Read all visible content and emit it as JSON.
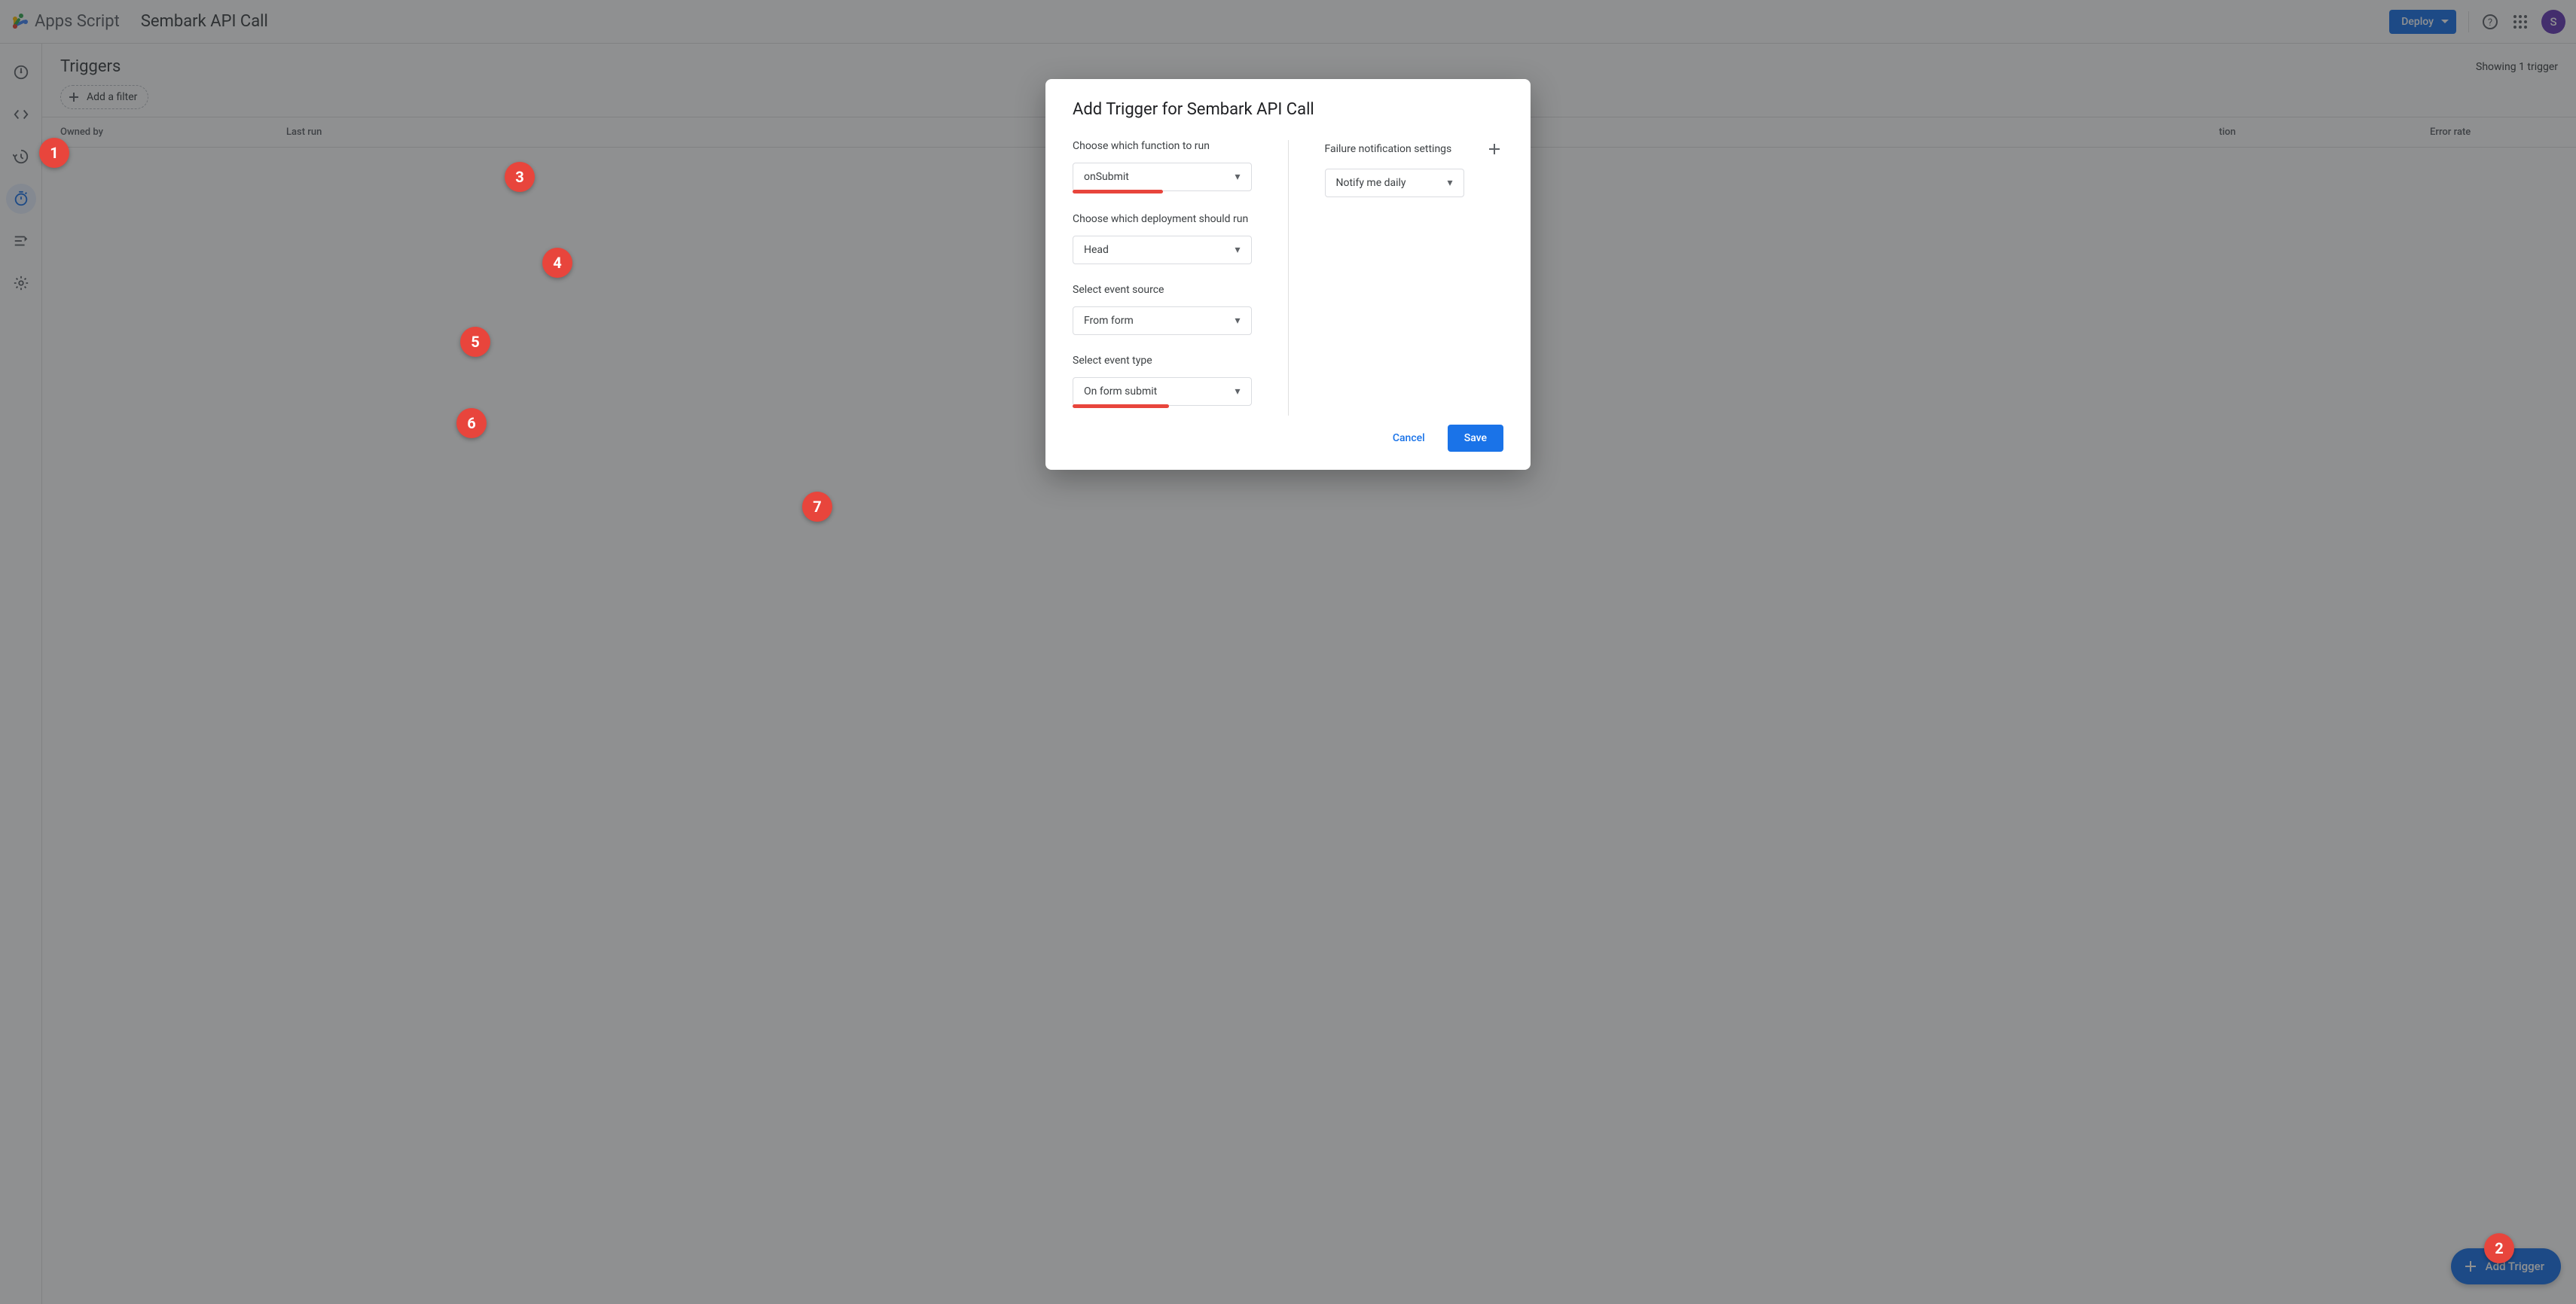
{
  "header": {
    "product_name": "Apps Script",
    "project_name": "Sembark API Call",
    "deploy_label": "Deploy",
    "avatar_initial": "S"
  },
  "main": {
    "title": "Triggers",
    "count_text": "Showing 1 trigger",
    "add_filter_label": "Add a filter",
    "columns": {
      "owned": "Owned by",
      "last_run": "Last run",
      "function": "tion",
      "error_rate": "Error rate"
    },
    "fab_label": "Add Trigger"
  },
  "dialog": {
    "title": "Add Trigger for Sembark API Call",
    "fields": {
      "function_label": "Choose which function to run",
      "function_value": "onSubmit",
      "deployment_label": "Choose which deployment should run",
      "deployment_value": "Head",
      "event_source_label": "Select event source",
      "event_source_value": "From form",
      "event_type_label": "Select event type",
      "event_type_value": "On form submit",
      "notif_label": "Failure notification settings",
      "notif_value": "Notify me daily"
    },
    "cancel_label": "Cancel",
    "save_label": "Save"
  },
  "annotations": [
    "1",
    "2",
    "3",
    "4",
    "5",
    "6",
    "7"
  ]
}
